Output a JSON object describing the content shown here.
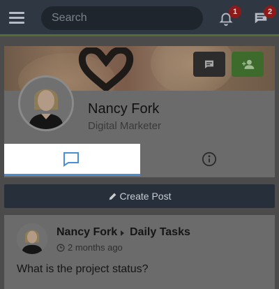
{
  "header": {
    "search_placeholder": "Search",
    "notifications_count": "1",
    "messages_count": "2"
  },
  "profile": {
    "name": "Nancy Fork",
    "role": "Digital Marketer"
  },
  "tabs": [
    {
      "icon": "comment-icon",
      "active": true
    },
    {
      "icon": "info-icon",
      "active": false
    }
  ],
  "actions": {
    "create_post_label": "Create Post"
  },
  "post": {
    "author": "Nancy Fork",
    "group": "Daily Tasks",
    "time": "2 months ago",
    "text": "What is the project status?"
  },
  "colors": {
    "topbar": "#2f3742",
    "accent_tab": "#4a8fd6",
    "badge": "#8b1a1a",
    "follow_button": "#3d6b2c"
  }
}
